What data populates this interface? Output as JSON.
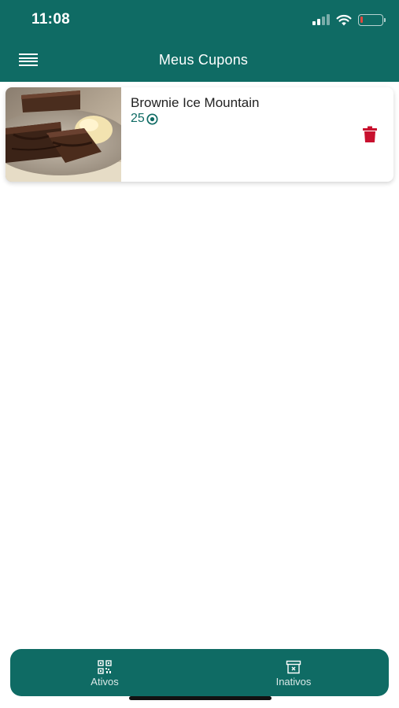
{
  "status_bar": {
    "time": "11:08",
    "icons": [
      "cellular-signal-icon",
      "wifi-icon",
      "battery-icon"
    ],
    "battery_level": 0.12
  },
  "app_bar": {
    "title": "Meus Cupons",
    "menu_icon": "hamburger-menu-icon"
  },
  "coupons": [
    {
      "image": "brownie-with-ice-cream-photo",
      "name": "Brownie Ice Mountain",
      "points": "25",
      "points_icon": "coin-icon",
      "delete_icon": "trash-icon"
    }
  ],
  "tabs": [
    {
      "label": "Ativos",
      "icon": "qr-code-icon"
    },
    {
      "label": "Inativos",
      "icon": "archive-box-icon"
    }
  ],
  "colors": {
    "primary": "#0f6b64",
    "delete": "#c8102e",
    "battery_low": "#e2483d"
  }
}
